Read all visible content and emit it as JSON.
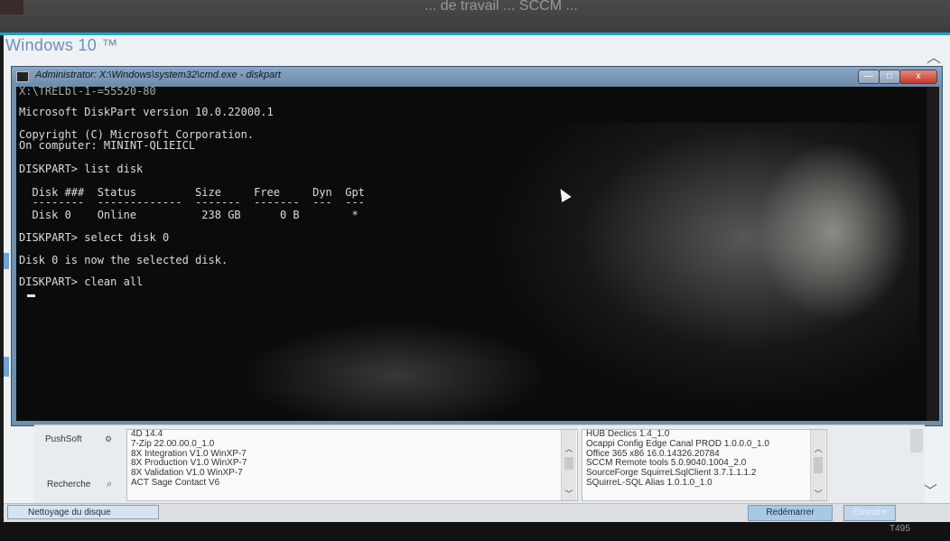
{
  "background": {
    "top_ghost_text": "... de travail ... SCCM ..."
  },
  "app": {
    "title": "Windows 10 ™"
  },
  "cmd": {
    "title": "Administrator: X:\\Windows\\system32\\cmd.exe - diskpart",
    "buttons": {
      "minimize": "—",
      "maximize": "□",
      "close": "x"
    },
    "lines": [
      "X:\\TRELbl-1-=55520-80",
      "Microsoft DiskPart version 10.0.22000.1",
      "Copyright (C) Microsoft Corporation.",
      "On computer: MININT-QL1EICL",
      "DISKPART> list disk",
      "  Disk ###  Status         Size     Free     Dyn  Gpt",
      "  --------  -------------  -------  -------  ---  ---",
      "  Disk 0    Online          238 GB      0 B        *",
      "DISKPART> select disk 0",
      "Disk 0 is now the selected disk.",
      "DISKPART> clean all"
    ]
  },
  "panel": {
    "pushsoft_label": "PushSoft",
    "search_label": "Recherche",
    "list_left": [
      "4D 14.4",
      "7-Zip 22.00.00.0_1.0",
      "8X Integration V1.0 WinXP-7",
      "8X Production V1.0 WinXP-7",
      "8X Validation V1.0 WinXP-7",
      "ACT Sage Contact V6"
    ],
    "list_right": [
      "HUB Declics 1.4_1.0",
      "Ocappi Config Edge Canal PROD 1.0.0.0_1.0",
      "Office 365 x86 16.0.14326.20784",
      "SCCM Remote tools 5.0.9040.1004_2.0",
      "SourceForge SquirreLSqlClient 3.7.1.1.1.2",
      "SQuirreL-SQL Alias 1.0.1.0_1.0"
    ]
  },
  "status_bar": {
    "disk_clean_label": "Nettoyage du disque",
    "restart_label": "Redémarrer",
    "shutdown_label": "Eteindre"
  },
  "bezel": {
    "brand": "T495"
  },
  "icons": {
    "pushsoft": "gear-icon",
    "search": "search-icon",
    "scroll_up": "chevron-up-icon",
    "scroll_down": "chevron-down-icon"
  }
}
